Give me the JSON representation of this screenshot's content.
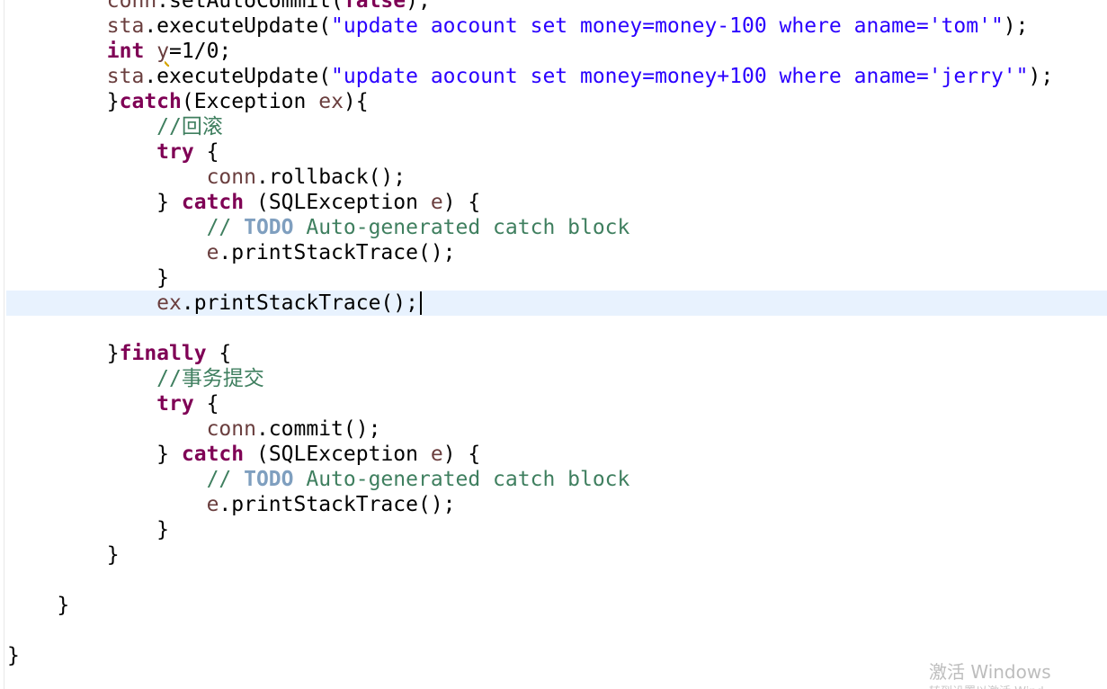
{
  "editor": {
    "lines": [
      {
        "indent": "        ",
        "tokens": [
          {
            "t": "conn",
            "c": "var"
          },
          {
            "t": ".setAutoCommit(",
            "c": ""
          },
          {
            "t": "false",
            "c": "kw"
          },
          {
            "t": ");",
            "c": ""
          }
        ]
      },
      {
        "indent": "        ",
        "tokens": [
          {
            "t": "sta",
            "c": "var"
          },
          {
            "t": ".executeUpdate(",
            "c": ""
          },
          {
            "t": "\"update aocount set money=money-100 where aname='tom'\"",
            "c": "str"
          },
          {
            "t": ");",
            "c": ""
          }
        ]
      },
      {
        "indent": "        ",
        "tokens": [
          {
            "t": "int",
            "c": "kw"
          },
          {
            "t": " ",
            "c": ""
          },
          {
            "t": "y",
            "c": "var warn"
          },
          {
            "t": "=1/0;",
            "c": ""
          }
        ]
      },
      {
        "indent": "        ",
        "tokens": [
          {
            "t": "sta",
            "c": "var"
          },
          {
            "t": ".executeUpdate(",
            "c": ""
          },
          {
            "t": "\"update aocount set money=money+100 where aname='jerry'\"",
            "c": "str"
          },
          {
            "t": ");",
            "c": ""
          }
        ]
      },
      {
        "indent": "        ",
        "tokens": [
          {
            "t": "}",
            "c": ""
          },
          {
            "t": "catch",
            "c": "kw"
          },
          {
            "t": "(Exception ",
            "c": ""
          },
          {
            "t": "ex",
            "c": "var"
          },
          {
            "t": "){",
            "c": ""
          }
        ]
      },
      {
        "indent": "            ",
        "tokens": [
          {
            "t": "//回滚",
            "c": "cm"
          }
        ]
      },
      {
        "indent": "            ",
        "tokens": [
          {
            "t": "try",
            "c": "kw"
          },
          {
            "t": " {",
            "c": ""
          }
        ]
      },
      {
        "indent": "                ",
        "tokens": [
          {
            "t": "conn",
            "c": "var"
          },
          {
            "t": ".rollback();",
            "c": ""
          }
        ]
      },
      {
        "indent": "            ",
        "tokens": [
          {
            "t": "} ",
            "c": ""
          },
          {
            "t": "catch",
            "c": "kw"
          },
          {
            "t": " (SQLException ",
            "c": ""
          },
          {
            "t": "e",
            "c": "var"
          },
          {
            "t": ") {",
            "c": ""
          }
        ]
      },
      {
        "indent": "                ",
        "tokens": [
          {
            "t": "// ",
            "c": "cm"
          },
          {
            "t": "TODO",
            "c": "todo"
          },
          {
            "t": " Auto-generated catch block",
            "c": "cm"
          }
        ]
      },
      {
        "indent": "                ",
        "tokens": [
          {
            "t": "e",
            "c": "var"
          },
          {
            "t": ".printStackTrace();",
            "c": ""
          }
        ]
      },
      {
        "indent": "            ",
        "tokens": [
          {
            "t": "}",
            "c": ""
          }
        ]
      },
      {
        "indent": "            ",
        "current": true,
        "caret": true,
        "tokens": [
          {
            "t": "ex",
            "c": "var"
          },
          {
            "t": ".printStackTrace();",
            "c": ""
          }
        ]
      },
      {
        "indent": "",
        "tokens": []
      },
      {
        "indent": "        ",
        "tokens": [
          {
            "t": "}",
            "c": ""
          },
          {
            "t": "finally",
            "c": "kw"
          },
          {
            "t": " {",
            "c": ""
          }
        ]
      },
      {
        "indent": "            ",
        "tokens": [
          {
            "t": "//事务提交",
            "c": "cm"
          }
        ]
      },
      {
        "indent": "            ",
        "tokens": [
          {
            "t": "try",
            "c": "kw"
          },
          {
            "t": " {",
            "c": ""
          }
        ]
      },
      {
        "indent": "                ",
        "tokens": [
          {
            "t": "conn",
            "c": "var"
          },
          {
            "t": ".commit();",
            "c": ""
          }
        ]
      },
      {
        "indent": "            ",
        "tokens": [
          {
            "t": "} ",
            "c": ""
          },
          {
            "t": "catch",
            "c": "kw"
          },
          {
            "t": " (SQLException ",
            "c": ""
          },
          {
            "t": "e",
            "c": "var"
          },
          {
            "t": ") {",
            "c": ""
          }
        ]
      },
      {
        "indent": "                ",
        "tokens": [
          {
            "t": "// ",
            "c": "cm"
          },
          {
            "t": "TODO",
            "c": "todo"
          },
          {
            "t": " Auto-generated catch block",
            "c": "cm"
          }
        ]
      },
      {
        "indent": "                ",
        "tokens": [
          {
            "t": "e",
            "c": "var"
          },
          {
            "t": ".printStackTrace();",
            "c": ""
          }
        ]
      },
      {
        "indent": "            ",
        "tokens": [
          {
            "t": "}",
            "c": ""
          }
        ]
      },
      {
        "indent": "        ",
        "tokens": [
          {
            "t": "}",
            "c": ""
          }
        ]
      },
      {
        "indent": "",
        "tokens": []
      },
      {
        "indent": "    ",
        "tokens": [
          {
            "t": "}",
            "c": ""
          }
        ]
      },
      {
        "indent": "",
        "tokens": []
      },
      {
        "indent": "",
        "tokens": [
          {
            "t": "}",
            "c": ""
          }
        ]
      }
    ]
  },
  "watermark": {
    "title": "激活 Windows",
    "subtitle": "转到设置以激活 Wind"
  },
  "colors": {
    "keyword": "#7f0055",
    "string": "#2a00ff",
    "variable": "#6a3e3e",
    "comment": "#3f7f5f",
    "todo_tag": "#7f9fbf",
    "current_line_highlight": "#e8f2fe",
    "warning_underline": "#d6a400"
  }
}
